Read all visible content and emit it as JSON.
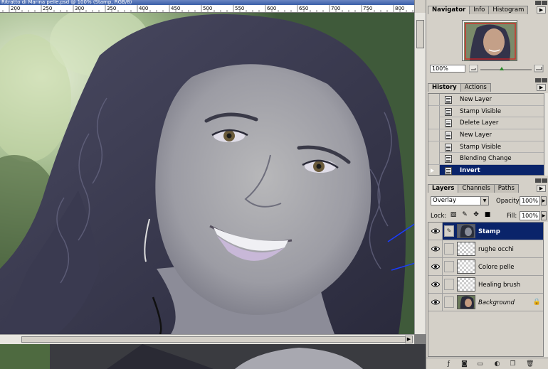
{
  "document": {
    "title": "Ritratto di Marina pelle.psd @ 100% (Stamp, RGB/8)",
    "ruler_ticks": [
      "200",
      "250",
      "300",
      "350",
      "400",
      "450",
      "500",
      "550",
      "600",
      "650",
      "700",
      "750",
      "800"
    ]
  },
  "navigator": {
    "tabs": [
      {
        "label": "Navigator",
        "active": true
      },
      {
        "label": "Info",
        "active": false
      },
      {
        "label": "Histogram",
        "active": false
      }
    ],
    "zoom": "100%"
  },
  "history": {
    "tabs": [
      {
        "label": "History",
        "active": true
      },
      {
        "label": "Actions",
        "active": false
      }
    ],
    "items": [
      {
        "label": "New Layer",
        "selected": false
      },
      {
        "label": "Stamp Visible",
        "selected": false
      },
      {
        "label": "Delete Layer",
        "selected": false
      },
      {
        "label": "New Layer",
        "selected": false
      },
      {
        "label": "Stamp Visible",
        "selected": false
      },
      {
        "label": "Blending Change",
        "selected": false
      },
      {
        "label": "Invert",
        "selected": true
      }
    ]
  },
  "layers": {
    "tabs": [
      {
        "label": "Layers",
        "active": true
      },
      {
        "label": "Channels",
        "active": false
      },
      {
        "label": "Paths",
        "active": false
      }
    ],
    "blend_mode": "Overlay",
    "opacity_label": "Opacity:",
    "opacity": "100%",
    "lock_label": "Lock:",
    "fill_label": "Fill:",
    "fill": "100%",
    "items": [
      {
        "name": "Stamp",
        "selected": true,
        "visible": true,
        "italic": false
      },
      {
        "name": "rughe occhi",
        "selected": false,
        "visible": true,
        "italic": false
      },
      {
        "name": "Colore pelle",
        "selected": false,
        "visible": true,
        "italic": false
      },
      {
        "name": "Healing brush",
        "selected": false,
        "visible": true,
        "italic": false
      },
      {
        "name": "Background",
        "selected": false,
        "visible": true,
        "italic": true,
        "locked": true
      }
    ]
  },
  "colors": {
    "selection": "#0a246a",
    "annotation_arrow": "#1a3cff",
    "panel": "#d4d0c8"
  }
}
